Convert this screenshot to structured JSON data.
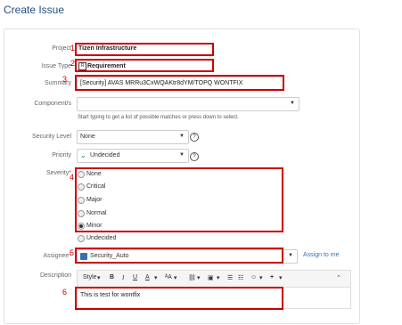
{
  "page": {
    "title": "Create Issue"
  },
  "form": {
    "project": {
      "label": "Project",
      "value": "Tizen Infrastructure",
      "required": "*"
    },
    "issue_type": {
      "label": "Issue Type",
      "value": "Requirement",
      "required": "*"
    },
    "summary": {
      "label": "Summary",
      "value": "[Security] AVAS MRRu3CxWQAKtr8dYM/TOPQ WONTFIX",
      "required": "*"
    },
    "components": {
      "label": "Component/s",
      "hint": "Start typing to get a list of possible matches or press down to select."
    },
    "security_level": {
      "label": "Security Level",
      "value": "None"
    },
    "priority": {
      "label": "Priority",
      "value": "Undecided"
    },
    "severity": {
      "label": "Severity",
      "required": "*",
      "options": [
        "None",
        "Critical",
        "Major",
        "Normal",
        "Minor",
        "Undecided"
      ],
      "selected": "Minor"
    },
    "assignee": {
      "label": "Assignee",
      "value": "Security_Auto",
      "required": "*",
      "assign_to_me": "Assign to me"
    },
    "description": {
      "label": "Description",
      "value": "This is test for wontfix"
    }
  },
  "toolbar": {
    "style_label": "Style"
  },
  "annotations": {
    "n1": "1",
    "n2": "2",
    "n3": "3",
    "n4": "4",
    "n5": "5",
    "n6": "6"
  }
}
